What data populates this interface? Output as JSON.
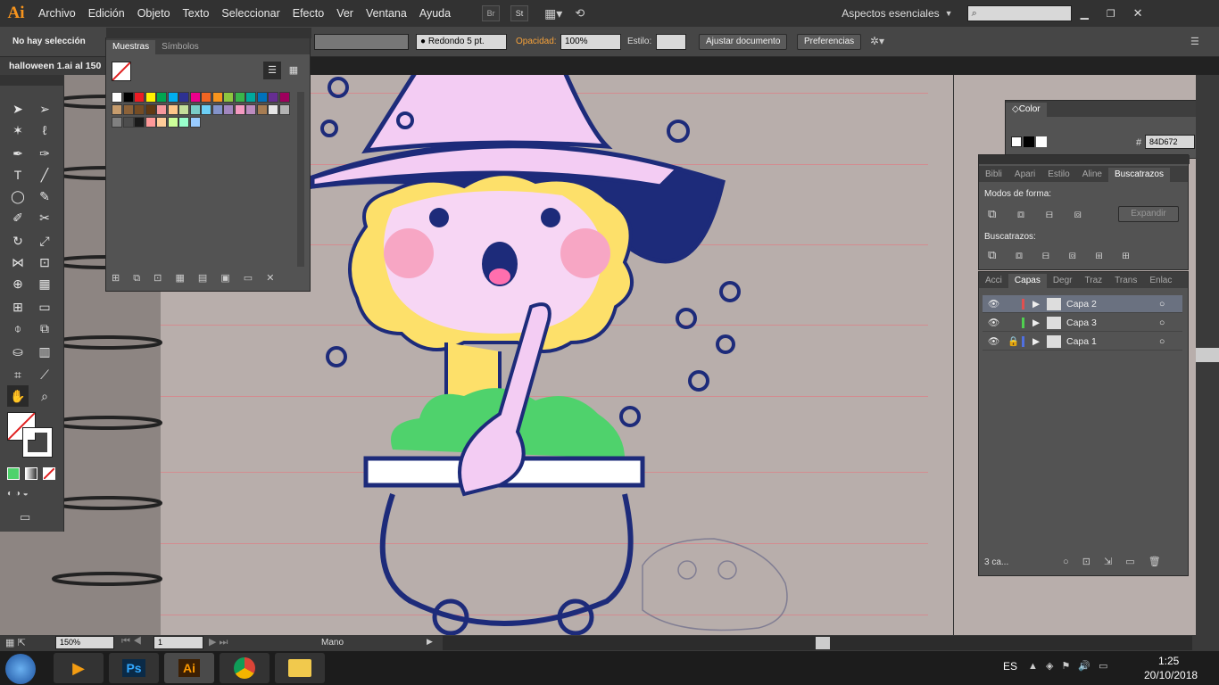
{
  "menu": {
    "logo": "Ai",
    "items": [
      "Archivo",
      "Edición",
      "Objeto",
      "Texto",
      "Seleccionar",
      "Efecto",
      "Ver",
      "Ventana",
      "Ayuda"
    ],
    "br": "Br",
    "st": "St",
    "workspace": "Aspectos esenciales"
  },
  "control": {
    "selection": "No hay selección",
    "stroke_profile": "Redondo 5 pt.",
    "opacity_label": "Opacidad:",
    "opacity": "100%",
    "style_label": "Estilo:",
    "fit_doc": "Ajustar documento",
    "prefs": "Preferencias"
  },
  "document": {
    "tab": "halloween 1.ai al 150"
  },
  "swatches": {
    "tab_active": "Muestras",
    "tab_other": "Símbolos"
  },
  "color": {
    "title": "Color",
    "hex_label": "#",
    "hex": "84D672"
  },
  "pathfinder": {
    "tabs": [
      "Bibli",
      "Apari",
      "Estilo",
      "Aline",
      "Buscatrazos"
    ],
    "shape_modes": "Modos de forma:",
    "expand": "Expandir",
    "pathfinders": "Buscatrazos:"
  },
  "layers": {
    "tabs": [
      "Acci",
      "Capas",
      "Degr",
      "Traz",
      "Trans",
      "Enlac"
    ],
    "rows": [
      {
        "name": "Capa 2",
        "color": "#e05050"
      },
      {
        "name": "Capa 3",
        "color": "#50d050"
      },
      {
        "name": "Capa 1",
        "color": "#5070e0"
      }
    ],
    "footer": "3 ca..."
  },
  "status": {
    "zoom": "150%",
    "page": "1",
    "tool": "Mano"
  },
  "taskbar": {
    "lang": "ES",
    "time": "1:25",
    "date": "20/10/2018"
  }
}
